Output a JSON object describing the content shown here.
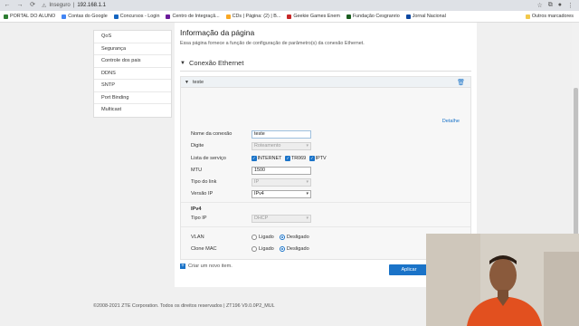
{
  "browser": {
    "security_label": "Inseguro",
    "url": "192.168.1.1",
    "bookmarks": [
      {
        "label": "PORTAL DO ALUNO",
        "color": "#2e7d32"
      },
      {
        "label": "Contas do Google",
        "color": "#4285f4"
      },
      {
        "label": "Concursos - Login",
        "color": "#1565c0"
      },
      {
        "label": "Centro de Integraçã...",
        "color": "#6a1b9a"
      },
      {
        "label": "CDs | Página: (2) | B...",
        "color": "#f9a825"
      },
      {
        "label": "Geekie Games Enem",
        "color": "#c62828"
      },
      {
        "label": "Fundação Cesgranrio",
        "color": "#1b5e20"
      },
      {
        "label": "Jornal Nacional",
        "color": "#0d47a1"
      }
    ],
    "other_bookmarks": "Outros marcadores"
  },
  "sidebar": {
    "items": [
      {
        "label": "QoS"
      },
      {
        "label": "Segurança"
      },
      {
        "label": "Controle dos pais"
      },
      {
        "label": "DDNS"
      },
      {
        "label": "SNTP"
      },
      {
        "label": "Port Binding"
      },
      {
        "label": "Multicast"
      }
    ]
  },
  "main": {
    "title": "Informação da página",
    "description": "Essa página fornece a função de configuração de parâmetro(s) da conexão Ethernet.",
    "section_title": "Conexão Ethernet",
    "connection": {
      "name": "teste",
      "details_link": "Detalhe",
      "fields": {
        "nome_label": "Nome da conexão",
        "nome_value": "teste",
        "digite_label": "Digite",
        "digite_value": "Roteamento",
        "servico_label": "Lista de serviço",
        "servicos": [
          "INTERNET",
          "TR069",
          "IPTV"
        ],
        "mtu_label": "MTU",
        "mtu_value": "1500",
        "tipo_link_label": "Tipo do link",
        "tipo_link_value": "IP",
        "versao_ip_label": "Versão IP",
        "versao_ip_value": "IPv4",
        "ipv4_header": "IPv4",
        "tipo_ip_label": "Tipo IP",
        "tipo_ip_value": "DHCP",
        "vlan_label": "VLAN",
        "clone_mac_label": "Clone MAC",
        "ligado": "Ligado",
        "desligado": "Desligado"
      },
      "apply_button": "Aplicar"
    },
    "new_item": "Criar um novo item."
  },
  "footer": {
    "text": "©2008-2021 ZTE Corporation. Todos os direitos reservados  |  ZT196 V9.0.0P2_MUL"
  }
}
